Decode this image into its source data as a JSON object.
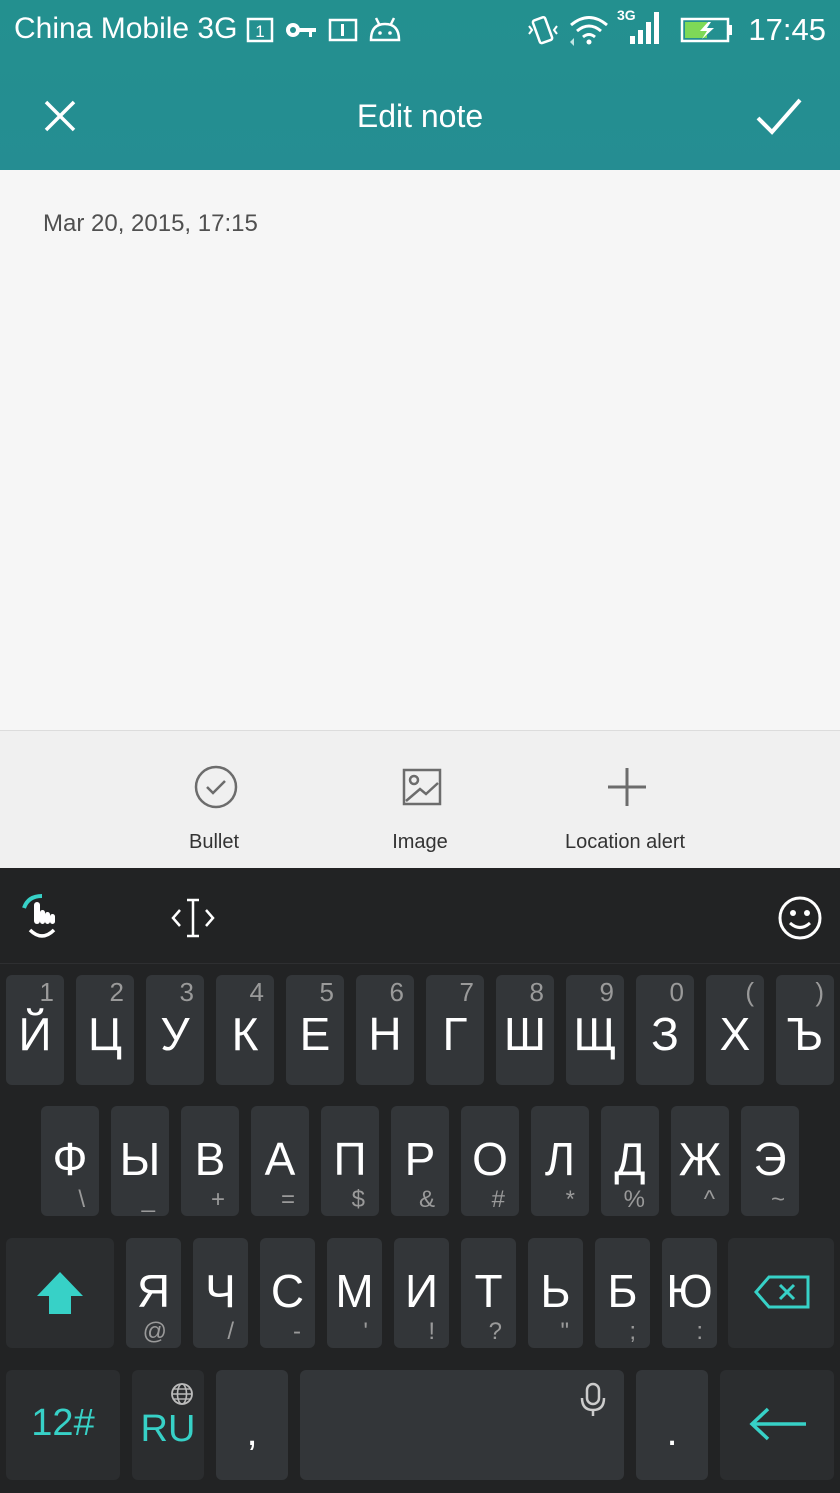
{
  "status_bar": {
    "carrier": "China Mobile 3G",
    "sim_badge": "1",
    "network_badge": "3G",
    "time": "17:45"
  },
  "header": {
    "title": "Edit note"
  },
  "note": {
    "timestamp": "Mar 20, 2015, 17:15",
    "body": ""
  },
  "toolbar": {
    "items": [
      {
        "label": "Bullet",
        "icon": "check-circle-icon"
      },
      {
        "label": "Image",
        "icon": "image-icon"
      },
      {
        "label": "Location alert",
        "icon": "plus-icon"
      }
    ]
  },
  "keyboard": {
    "row1": [
      {
        "main": "Й",
        "top": "1"
      },
      {
        "main": "Ц",
        "top": "2"
      },
      {
        "main": "У",
        "top": "3"
      },
      {
        "main": "К",
        "top": "4"
      },
      {
        "main": "Е",
        "top": "5"
      },
      {
        "main": "Н",
        "top": "6"
      },
      {
        "main": "Г",
        "top": "7"
      },
      {
        "main": "Ш",
        "top": "8"
      },
      {
        "main": "Щ",
        "top": "9"
      },
      {
        "main": "З",
        "top": "0"
      },
      {
        "main": "Х",
        "top": "("
      },
      {
        "main": "Ъ",
        "top": ")"
      }
    ],
    "row2": [
      {
        "main": "Ф",
        "sub": "\\"
      },
      {
        "main": "Ы",
        "sub": "_"
      },
      {
        "main": "В",
        "sub": "+"
      },
      {
        "main": "А",
        "sub": "="
      },
      {
        "main": "П",
        "sub": "$"
      },
      {
        "main": "Р",
        "sub": "&"
      },
      {
        "main": "О",
        "sub": "#"
      },
      {
        "main": "Л",
        "sub": "*"
      },
      {
        "main": "Д",
        "sub": "%"
      },
      {
        "main": "Ж",
        "sub": "^"
      },
      {
        "main": "Э",
        "sub": "~"
      }
    ],
    "row3": [
      {
        "main": "Я",
        "sub": "@"
      },
      {
        "main": "Ч",
        "sub": "/"
      },
      {
        "main": "С",
        "sub": "-"
      },
      {
        "main": "М",
        "sub": "'"
      },
      {
        "main": "И",
        "sub": "!"
      },
      {
        "main": "Т",
        "sub": "?"
      },
      {
        "main": "Ь",
        "sub": "\""
      },
      {
        "main": "Б",
        "sub": ";"
      },
      {
        "main": "Ю",
        "sub": ":"
      }
    ],
    "numbers_key": "12#",
    "lang_key": "RU",
    "comma_key": ",",
    "period_key": ".",
    "accent_color": "#37d1c7"
  }
}
